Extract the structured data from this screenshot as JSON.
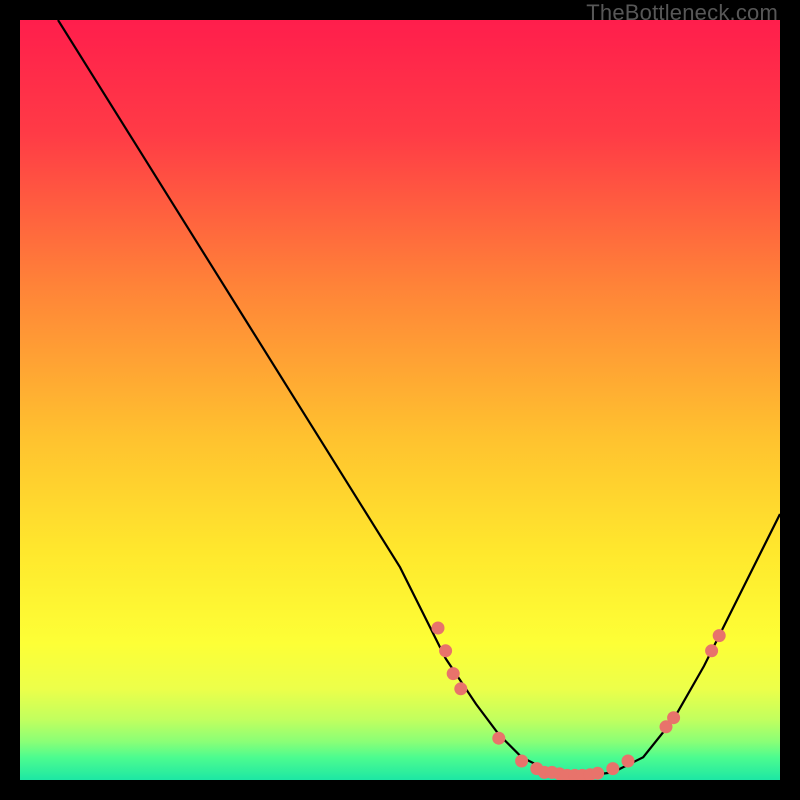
{
  "watermark": "TheBottleneck.com",
  "chart_data": {
    "type": "line",
    "title": "",
    "xlabel": "",
    "ylabel": "",
    "xlim": [
      0,
      100
    ],
    "ylim": [
      0,
      100
    ],
    "grid": false,
    "series": [
      {
        "name": "bottleneck-curve",
        "x": [
          5,
          10,
          15,
          20,
          25,
          30,
          35,
          40,
          45,
          50,
          53,
          56,
          60,
          63,
          66,
          70,
          74,
          78,
          82,
          86,
          90,
          95,
          100
        ],
        "y": [
          100,
          92,
          84,
          76,
          68,
          60,
          52,
          44,
          36,
          28,
          22,
          16,
          10,
          6,
          3,
          1,
          0.5,
          1,
          3,
          8,
          15,
          25,
          35
        ]
      }
    ],
    "scatter_points": {
      "name": "data-points",
      "color": "#e8736b",
      "points": [
        {
          "x": 55,
          "y": 20
        },
        {
          "x": 56,
          "y": 17
        },
        {
          "x": 57,
          "y": 14
        },
        {
          "x": 58,
          "y": 12
        },
        {
          "x": 63,
          "y": 5.5
        },
        {
          "x": 66,
          "y": 2.5
        },
        {
          "x": 68,
          "y": 1.5
        },
        {
          "x": 69,
          "y": 1
        },
        {
          "x": 70,
          "y": 1
        },
        {
          "x": 71,
          "y": 0.8
        },
        {
          "x": 72,
          "y": 0.6
        },
        {
          "x": 73,
          "y": 0.6
        },
        {
          "x": 74,
          "y": 0.6
        },
        {
          "x": 75,
          "y": 0.7
        },
        {
          "x": 76,
          "y": 0.9
        },
        {
          "x": 78,
          "y": 1.5
        },
        {
          "x": 80,
          "y": 2.5
        },
        {
          "x": 85,
          "y": 7
        },
        {
          "x": 86,
          "y": 8.2
        },
        {
          "x": 91,
          "y": 17
        },
        {
          "x": 92,
          "y": 19
        }
      ]
    },
    "gradient_stops": [
      {
        "offset": 0,
        "color": "#ff1e4c"
      },
      {
        "offset": 15,
        "color": "#ff3b46"
      },
      {
        "offset": 35,
        "color": "#ff8338"
      },
      {
        "offset": 55,
        "color": "#ffc22f"
      },
      {
        "offset": 70,
        "color": "#ffe82d"
      },
      {
        "offset": 82,
        "color": "#fdff36"
      },
      {
        "offset": 88,
        "color": "#ecff4a"
      },
      {
        "offset": 92,
        "color": "#c2ff5e"
      },
      {
        "offset": 95,
        "color": "#89ff77"
      },
      {
        "offset": 97,
        "color": "#4dfc8f"
      },
      {
        "offset": 100,
        "color": "#1de7a4"
      }
    ]
  }
}
